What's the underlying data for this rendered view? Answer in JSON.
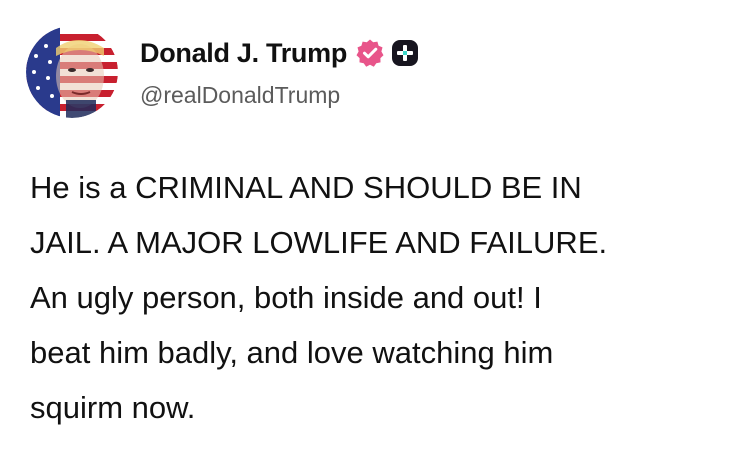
{
  "author": {
    "display_name": "Donald J. Trump",
    "handle": "@realDonaldTrump",
    "verified_color": "#e8558a",
    "badge_color": "#17151f"
  },
  "avatar": {
    "icon": "avatar-flag-portrait"
  },
  "post": {
    "lines": [
      "He is a CRIMINAL AND SHOULD BE IN",
      "JAIL. A MAJOR LOWLIFE AND FAILURE.",
      "An ugly person, both inside and out! I",
      "beat him badly, and love watching him",
      "squirm now."
    ]
  }
}
